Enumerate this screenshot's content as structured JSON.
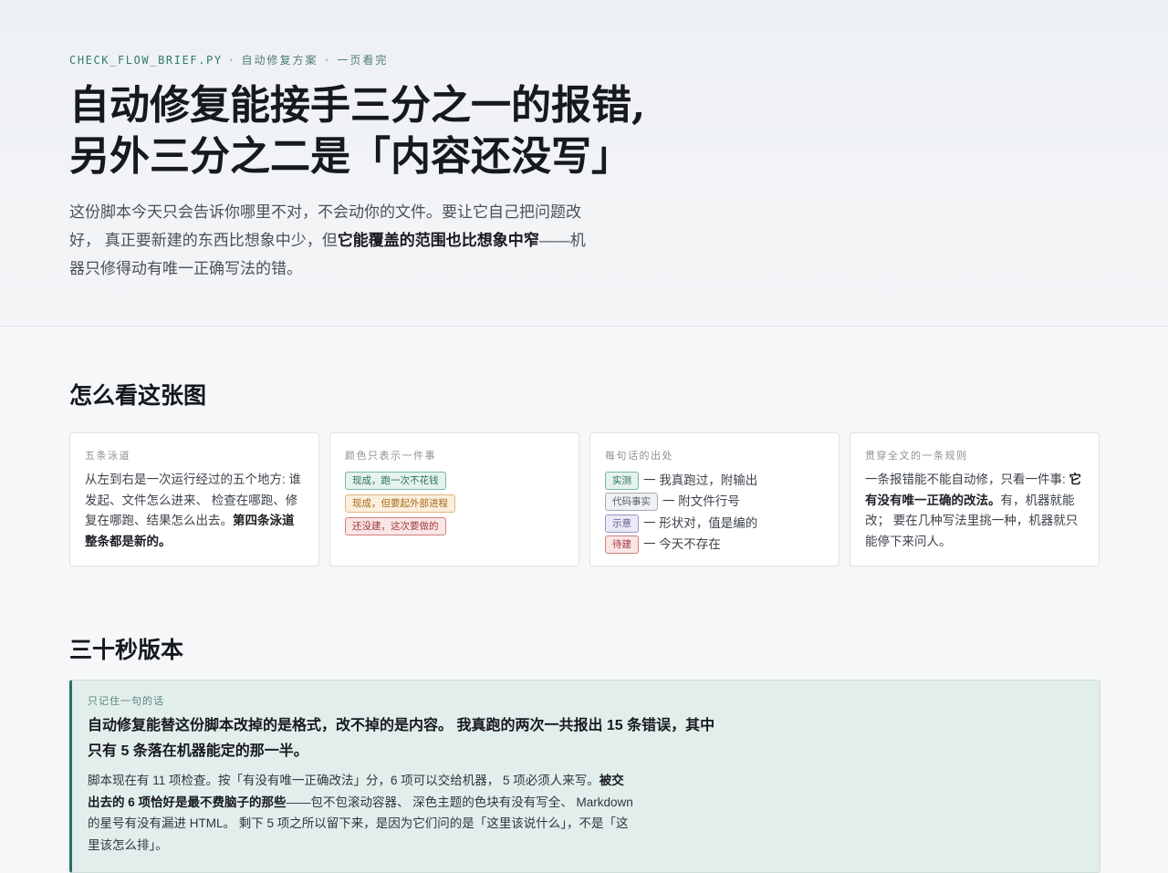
{
  "hero": {
    "kicker": {
      "filename": "CHECK_FLOW_BRIEF.PY",
      "separator": "·",
      "subject": "自动修复方案",
      "note": "一页看完"
    },
    "title_line1": "自动修复能接手三分之一的报错,",
    "title_line2": "另外三分之二是「内容还没写」",
    "lede": {
      "part1": "这份脚本今天只会告诉你哪里不对，不会动你的文件。要让它自己把问题改好， 真正要新建的东西比想象中少，但",
      "emphasis": "它能覆盖的范围也比想象中窄",
      "part2": "——机器只修得动有唯一正确写法的错。"
    }
  },
  "guide": {
    "heading": "怎么看这张图",
    "cards": [
      {
        "label": "五条泳道",
        "body": "从左到右是一次运行经过的五个地方: 谁发起、文件怎么进来、 检查在哪跑、修复在哪跑、结果怎么出去。",
        "emphasis": "第四条泳道整条都是新的。"
      },
      {
        "label": "颜色只表示一件事",
        "chips": [
          {
            "text": "现成，跑一次不花钱",
            "color": "#2a6f5e"
          },
          {
            "text": "现成，但要起外部进程",
            "color": "#a86a1b"
          },
          {
            "text": "还没建，这次要做的",
            "color": "#a33a3d"
          }
        ]
      },
      {
        "label": "每句话的出处",
        "sources": [
          {
            "tag": "实测",
            "desc": "一 我真跑过，附输出"
          },
          {
            "tag": "代码事实",
            "desc": "一 附文件行号"
          },
          {
            "tag": "示意",
            "desc": "一 形状对，值是编的"
          },
          {
            "tag": "待建",
            "desc": "一 今天不存在"
          }
        ]
      },
      {
        "label": "贯穿全文的一条规则",
        "part1": "一条报错能不能自动修，只看一件事: ",
        "emphasis": "它有没有唯一正确的改法。",
        "part2": "有，机器就能改； 要在几种写法里挑一种，机器就只能停下来问人。"
      }
    ]
  },
  "summary": {
    "heading": "三十秒版本",
    "callout_label": "只记住一句的话",
    "lead": "自动修复能替这份脚本改掉的是格式，改不掉的是内容。 我真跑的两次一共报出 15 条错误，其中只有 5 条落在机器能定的那一半。",
    "body_part1": "脚本现在有 11 项检查。按「有没有唯一正确改法」分，6 项可以交给机器， 5 项必须人来写。",
    "body_emphasis": "被交出去的 6 项恰好是最不费脑子的那些",
    "body_part2": "——包不包滚动容器、 深色主题的色块有没有写全、 Markdown 的星号有没有漏进 HTML。 剩下 5 项之所以留下来，是因为它们问的是「这里该说什么」，不是「这里该怎么排」。"
  }
}
